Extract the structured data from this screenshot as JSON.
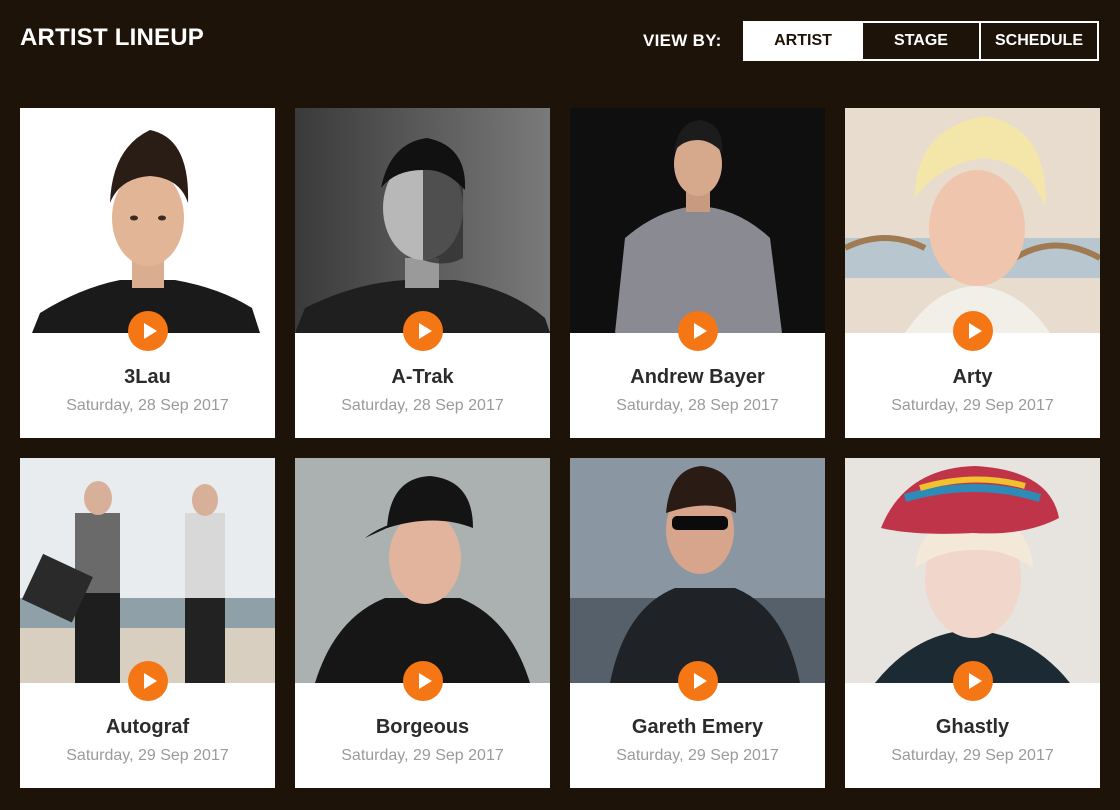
{
  "header": {
    "title": "ARTIST LINEUP",
    "view_by_label": "VIEW BY:",
    "tabs": [
      {
        "label": "ARTIST",
        "active": true
      },
      {
        "label": "STAGE",
        "active": false
      },
      {
        "label": "SCHEDULE",
        "active": false
      }
    ]
  },
  "colors": {
    "background": "#1d1309",
    "accent": "#f57614",
    "card": "#ffffff"
  },
  "artists": [
    {
      "name": "3Lau",
      "date": "Saturday, 28 Sep 2017"
    },
    {
      "name": "A-Trak",
      "date": "Saturday, 28 Sep 2017"
    },
    {
      "name": "Andrew Bayer",
      "date": "Saturday, 28 Sep 2017"
    },
    {
      "name": "Arty",
      "date": "Saturday, 29 Sep 2017"
    },
    {
      "name": "Autograf",
      "date": "Saturday, 29 Sep 2017"
    },
    {
      "name": "Borgeous",
      "date": "Saturday, 29 Sep 2017"
    },
    {
      "name": "Gareth Emery",
      "date": "Saturday, 29 Sep 2017"
    },
    {
      "name": "Ghastly",
      "date": "Saturday, 29 Sep 2017"
    }
  ]
}
